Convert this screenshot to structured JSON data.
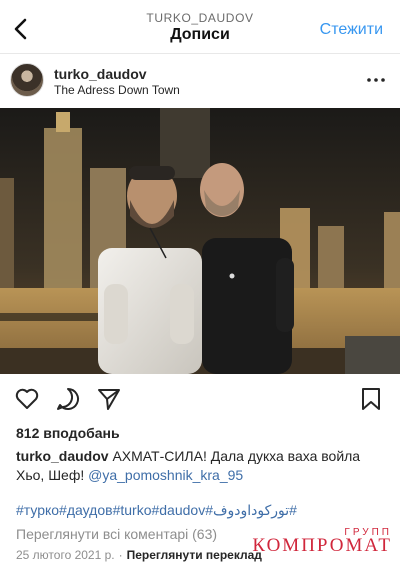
{
  "header": {
    "account_handle": "TURKO_DAUDOV",
    "title": "Дописи",
    "follow_label": "Стежити"
  },
  "post": {
    "username": "turko_daudov",
    "location": "The Adress Down Town",
    "likes": "812 вподобань",
    "caption_username": "turko_daudov",
    "caption_text": " АХМАТ-СИЛА!  Дала дукха ваха войла Хьо, Шеф! ",
    "caption_mention": "@ya_pomoshnik_kra_95",
    "hashtags": "#турко#даудов#turko#daudov#توركوداودوف#",
    "view_comments": "Переглянути всі коментарі (63)",
    "date": "25 лютого 2021 р.",
    "translate_label": "Переглянути переклад"
  },
  "watermark": {
    "small": "ГРУПП",
    "big": "КОМПРОМАТ"
  },
  "colors": {
    "link": "#3f6ea8",
    "follow": "#3897f0",
    "watermark": "#d0263b"
  },
  "icons": [
    "back-chevron-icon",
    "more-options-icon",
    "heart-icon",
    "comment-icon",
    "share-icon",
    "bookmark-icon"
  ]
}
